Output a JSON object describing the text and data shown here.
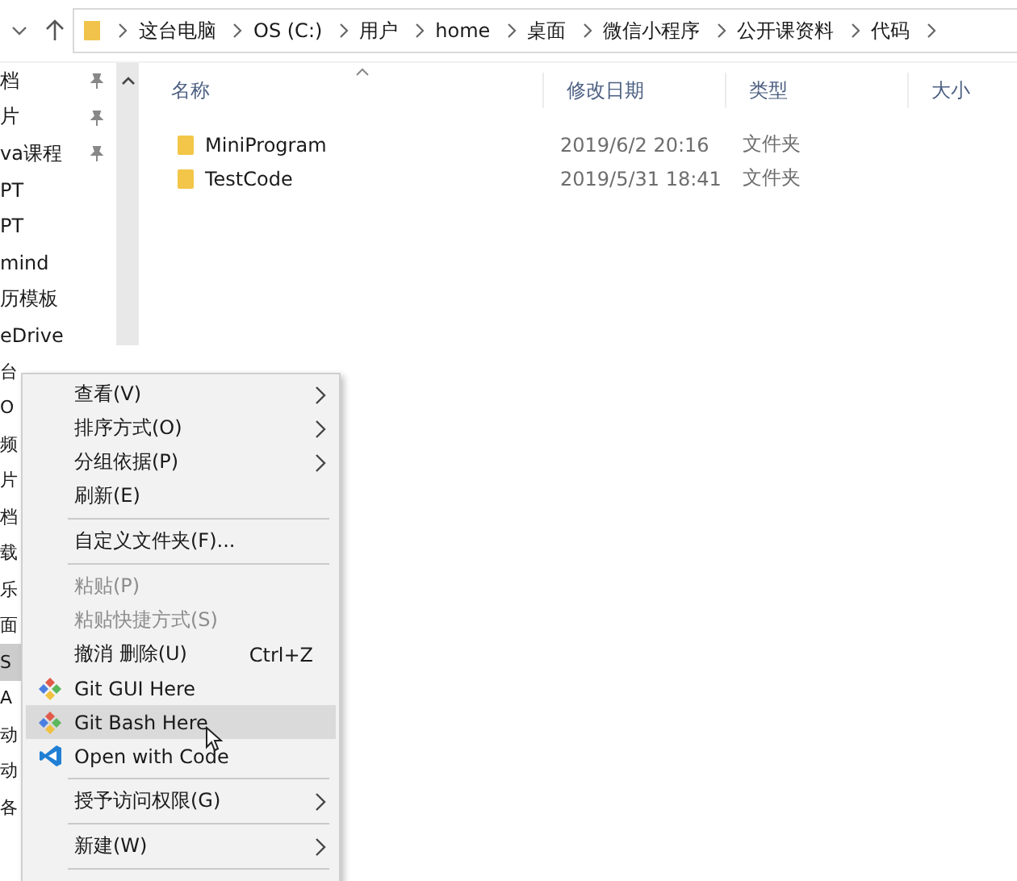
{
  "address_bar": {
    "crumbs": [
      "这台电脑",
      "OS (C:)",
      "用户",
      "home",
      "桌面",
      "微信小程序",
      "公开课资料",
      "代码"
    ]
  },
  "sidebar": {
    "items": [
      {
        "label": "档",
        "pinned": true,
        "selected": false
      },
      {
        "label": "片",
        "pinned": true,
        "selected": false
      },
      {
        "label": "va课程",
        "pinned": true,
        "selected": false
      },
      {
        "label": "PT",
        "pinned": false,
        "selected": false
      },
      {
        "label": "PT",
        "pinned": false,
        "selected": false
      },
      {
        "label": "mind",
        "pinned": false,
        "selected": false
      },
      {
        "label": "历模板",
        "pinned": false,
        "selected": false
      },
      {
        "label": "eDrive",
        "pinned": false,
        "selected": false
      },
      {
        "label": "台",
        "pinned": false,
        "selected": false
      },
      {
        "label": "O",
        "pinned": false,
        "selected": false
      },
      {
        "label": "频",
        "pinned": false,
        "selected": false
      },
      {
        "label": "片",
        "pinned": false,
        "selected": false
      },
      {
        "label": "档",
        "pinned": false,
        "selected": false
      },
      {
        "label": "载",
        "pinned": false,
        "selected": false
      },
      {
        "label": "乐",
        "pinned": false,
        "selected": false
      },
      {
        "label": "面",
        "pinned": false,
        "selected": false
      },
      {
        "label": "S",
        "pinned": false,
        "selected": true
      },
      {
        "label": "A",
        "pinned": false,
        "selected": false
      },
      {
        "label": "动",
        "pinned": false,
        "selected": false
      },
      {
        "label": "动",
        "pinned": false,
        "selected": false
      },
      {
        "label": "各",
        "pinned": false,
        "selected": false
      }
    ]
  },
  "file_list": {
    "columns": [
      {
        "label": "名称",
        "sorted": true
      },
      {
        "label": "修改日期",
        "sorted": false
      },
      {
        "label": "类型",
        "sorted": false
      },
      {
        "label": "大小",
        "sorted": false
      }
    ],
    "rows": [
      {
        "name": "MiniProgram",
        "modified": "2019/6/2 20:16",
        "type": "文件夹"
      },
      {
        "name": "TestCode",
        "modified": "2019/5/31 18:41",
        "type": "文件夹"
      }
    ]
  },
  "context_menu": {
    "items": [
      {
        "kind": "item",
        "label": "查看(V)",
        "submenu": true,
        "disabled": false,
        "selected": false
      },
      {
        "kind": "item",
        "label": "排序方式(O)",
        "submenu": true,
        "disabled": false,
        "selected": false
      },
      {
        "kind": "item",
        "label": "分组依据(P)",
        "submenu": true,
        "disabled": false,
        "selected": false
      },
      {
        "kind": "item",
        "label": "刷新(E)",
        "submenu": false,
        "disabled": false,
        "selected": false
      },
      {
        "kind": "separator"
      },
      {
        "kind": "item",
        "label": "自定义文件夹(F)...",
        "submenu": false,
        "disabled": false,
        "selected": false
      },
      {
        "kind": "separator"
      },
      {
        "kind": "item",
        "label": "粘贴(P)",
        "submenu": false,
        "disabled": true,
        "selected": false
      },
      {
        "kind": "item",
        "label": "粘贴快捷方式(S)",
        "submenu": false,
        "disabled": true,
        "selected": false
      },
      {
        "kind": "item",
        "label": "撤消 删除(U)",
        "shortcut": "Ctrl+Z",
        "submenu": false,
        "disabled": false,
        "selected": false
      },
      {
        "kind": "git",
        "label": "Git GUI Here",
        "submenu": false,
        "disabled": false,
        "selected": false
      },
      {
        "kind": "git",
        "label": "Git Bash Here",
        "submenu": false,
        "disabled": false,
        "selected": true
      },
      {
        "kind": "code",
        "label": "Open with Code",
        "submenu": false,
        "disabled": false,
        "selected": false
      },
      {
        "kind": "separator"
      },
      {
        "kind": "item",
        "label": "授予访问权限(G)",
        "submenu": true,
        "disabled": false,
        "selected": false
      },
      {
        "kind": "separator"
      },
      {
        "kind": "item",
        "label": "新建(W)",
        "submenu": true,
        "disabled": false,
        "selected": false
      },
      {
        "kind": "separator"
      }
    ]
  }
}
